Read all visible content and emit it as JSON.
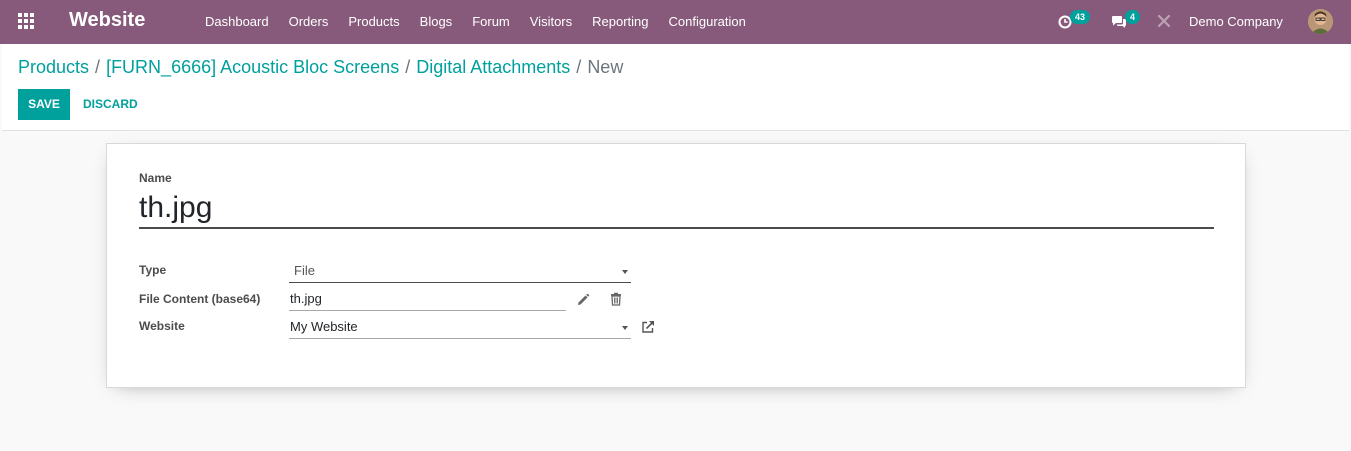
{
  "navbar": {
    "app_title": "Website",
    "menu": [
      "Dashboard",
      "Orders",
      "Products",
      "Blogs",
      "Forum",
      "Visitors",
      "Reporting",
      "Configuration"
    ],
    "activity_count": "43",
    "message_count": "4",
    "company": "Demo Company",
    "bg_color": "#875a7b"
  },
  "breadcrumb": {
    "items": [
      "Products",
      "[FURN_6666] Acoustic Bloc Screens",
      "Digital Attachments"
    ],
    "current": "New",
    "separator": "/"
  },
  "buttons": {
    "save": "SAVE",
    "discard": "DISCARD"
  },
  "form": {
    "name_label": "Name",
    "name_value": "th.jpg",
    "type_label": "Type",
    "type_value": "File",
    "file_label": "File Content (base64)",
    "file_value": "th.jpg",
    "website_label": "Website",
    "website_value": "My Website"
  },
  "colors": {
    "accent": "#00a09d",
    "brand": "#875a7b"
  }
}
